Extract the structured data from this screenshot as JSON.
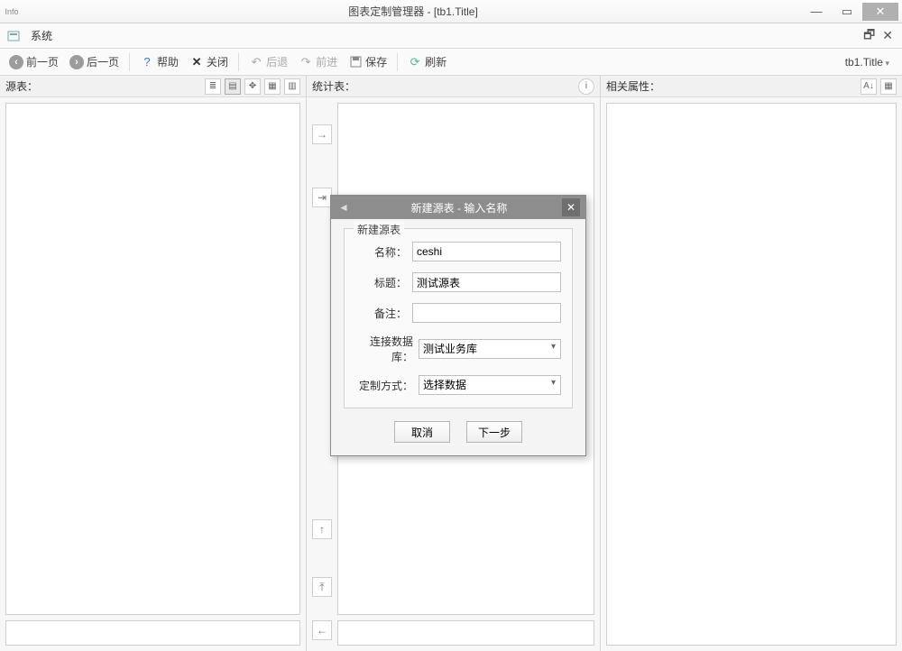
{
  "window": {
    "app_icon_label": "Info",
    "title": "图表定制管理器 - [tb1.Title]"
  },
  "menu": {
    "system": "系统"
  },
  "toolbar": {
    "prev": "前一页",
    "next": "后一页",
    "help": "帮助",
    "close": "关闭",
    "back": "后退",
    "forward": "前进",
    "save": "保存",
    "refresh": "刷新",
    "breadcrumb": "tb1.Title"
  },
  "panes": {
    "source": {
      "label": "源表："
    },
    "stat": {
      "label": "统计表："
    },
    "attr": {
      "label": "相关属性："
    }
  },
  "dialog": {
    "title": "新建源表 - 输入名称",
    "group": "新建源表",
    "fields": {
      "name_label": "名称：",
      "name_value": "ceshi",
      "title_label": "标题：",
      "title_value": "测试源表",
      "remark_label": "备注：",
      "remark_value": "",
      "db_label": "连接数据库：",
      "db_value": "测试业务库",
      "mode_label": "定制方式：",
      "mode_value": "选择数据"
    },
    "buttons": {
      "cancel": "取消",
      "next": "下一步"
    }
  }
}
